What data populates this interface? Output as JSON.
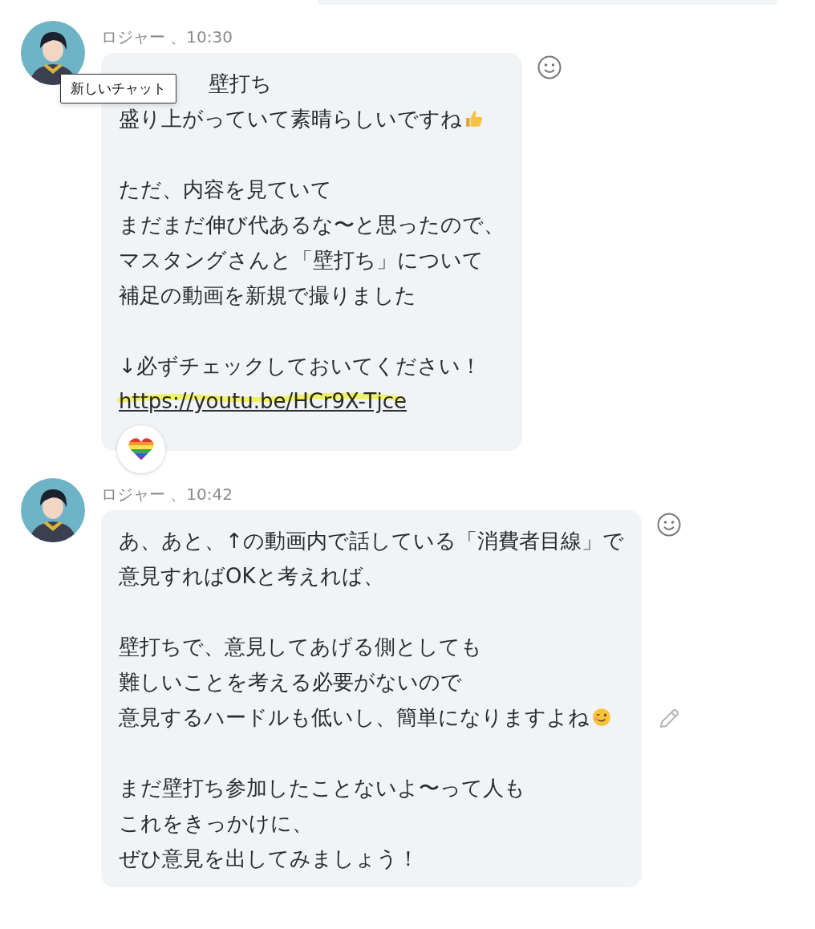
{
  "messages": [
    {
      "byline": "ロジャー 、10:30",
      "reaction_picker": true,
      "edit": false,
      "paragraphs": [
        [
          {
            "text": "壁打ち",
            "kind": "partly_hidden"
          },
          {
            "text": "盛り上がっていて素晴らしいですね",
            "kind": "thumbs_up"
          }
        ],
        [
          {
            "text": "ただ、内容を見ていて"
          },
          {
            "text": "まだまだ伸び代あるな〜と思ったので、"
          },
          {
            "text": "マスタングさんと「壁打ち」について"
          },
          {
            "text": "補足の動画を新規で撮りました"
          }
        ],
        [
          {
            "text": "↓必ずチェックしておいてください！"
          },
          {
            "text": "https://youtu.be/HCr9X-Tjce",
            "kind": "link",
            "highlighted": true
          }
        ]
      ],
      "reactions": [
        {
          "kind": "rainbow_heart"
        }
      ]
    },
    {
      "byline": "ロジャー 、10:42",
      "reaction_picker": true,
      "edit": true,
      "paragraphs": [
        [
          {
            "text": "あ、あと、↑の動画内で話している「消費者目線」で"
          },
          {
            "text": "意見すればOKと考えれば、"
          }
        ],
        [
          {
            "text": "壁打ちで、意見してあげる側としても"
          },
          {
            "text": "難しいことを考える必要がないので"
          },
          {
            "text": "意見するハードルも低いし、簡単になりますよね",
            "kind": "wink"
          }
        ],
        [
          {
            "text": "まだ壁打ち参加したことないよ〜って人も"
          },
          {
            "text": "これをきっかけに、"
          },
          {
            "text": "ぜひ意見を出してみましょう！"
          }
        ]
      ]
    }
  ],
  "tooltip": {
    "text": "新しいチャット"
  }
}
